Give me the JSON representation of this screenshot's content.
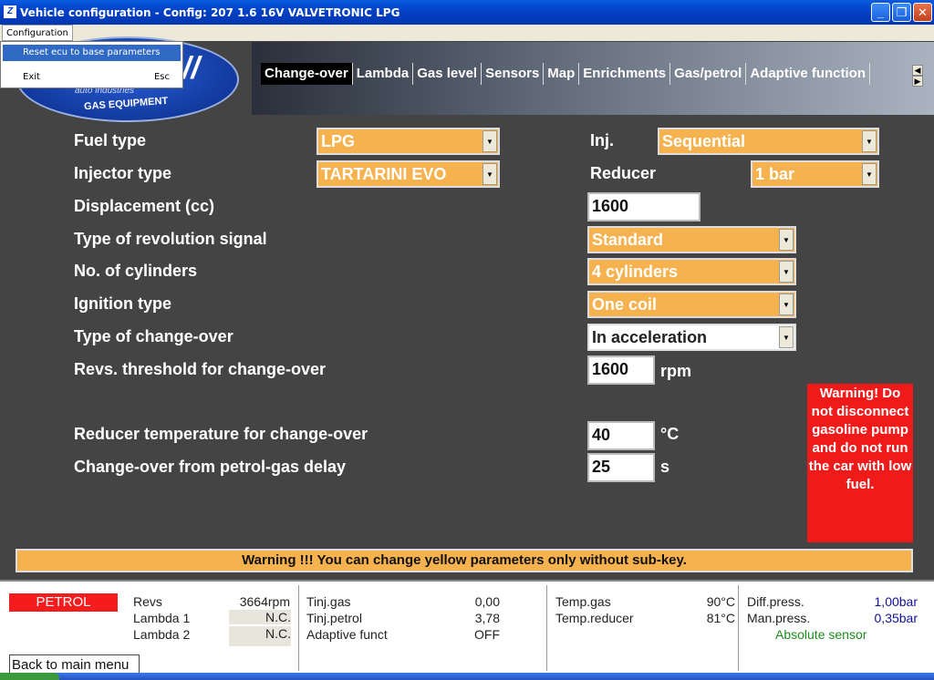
{
  "window": {
    "title": "Vehicle configuration - Config: 207 1.6 16V VALVETRONIC LPG"
  },
  "menu": {
    "configuration": "Configuration",
    "items": [
      {
        "label": "Reset ecu to base parameters",
        "shortcut": ""
      },
      {
        "label": "Exit",
        "shortcut": "Esc"
      }
    ]
  },
  "logo": {
    "line1": "auto industries",
    "line2": "GAS EQUIPMENT"
  },
  "tabs": [
    "Change-over",
    "Lambda",
    "Gas level",
    "Sensors",
    "Map",
    "Enrichments",
    "Gas/petrol",
    "Adaptive function"
  ],
  "form": {
    "fuel_type": {
      "label": "Fuel type",
      "value": "LPG"
    },
    "inj": {
      "label": "Inj.",
      "value": "Sequential"
    },
    "injector_type": {
      "label": "Injector type",
      "value": "TARTARINI EVO"
    },
    "reducer": {
      "label": "Reducer",
      "value": "1 bar"
    },
    "displacement": {
      "label": "Displacement (cc)",
      "value": "1600"
    },
    "rev_signal": {
      "label": "Type of revolution signal",
      "value": "Standard"
    },
    "cylinders": {
      "label": "No. of cylinders",
      "value": "4 cylinders"
    },
    "ignition": {
      "label": "Ignition type",
      "value": "One coil"
    },
    "changeover_type": {
      "label": "Type of change-over",
      "value": "In acceleration"
    },
    "revs_threshold": {
      "label": "Revs. threshold for change-over",
      "value": "1600",
      "unit": "rpm"
    },
    "reducer_temp": {
      "label": "Reducer temperature for change-over",
      "value": "40",
      "unit": "°C"
    },
    "delay": {
      "label": "Change-over from petrol-gas delay",
      "value": "25",
      "unit": "s"
    }
  },
  "warnings": {
    "red": "Warning! Do not disconnect gasoline pump and do not run the car with low fuel.",
    "bar": "Warning !!! You can change yellow parameters only without sub-key."
  },
  "status": {
    "mode": "PETROL",
    "revs_label": "Revs",
    "revs_value": "3664rpm",
    "lambda1_label": "Lambda 1",
    "lambda1_value": "N.C.",
    "lambda2_label": "Lambda 2",
    "lambda2_value": "N.C.",
    "tinj_gas_label": "Tinj.gas",
    "tinj_gas_value": "0,00",
    "tinj_petrol_label": "Tinj.petrol",
    "tinj_petrol_value": "3,78",
    "adaptive_label": "Adaptive funct",
    "adaptive_value": "OFF",
    "temp_gas_label": "Temp.gas",
    "temp_gas_value": "90°C",
    "temp_reducer_label": "Temp.reducer",
    "temp_reducer_value": "81°C",
    "diff_press_label": "Diff.press.",
    "diff_press_value": "1,00bar",
    "man_press_label": "Man.press.",
    "man_press_value": "0,35bar",
    "sensor": "Absolute sensor",
    "back_button": "Back to main menu"
  },
  "colors": {
    "field_orange": "#f6b24f",
    "warning_red": "#ef1b1b",
    "background": "#444444"
  }
}
